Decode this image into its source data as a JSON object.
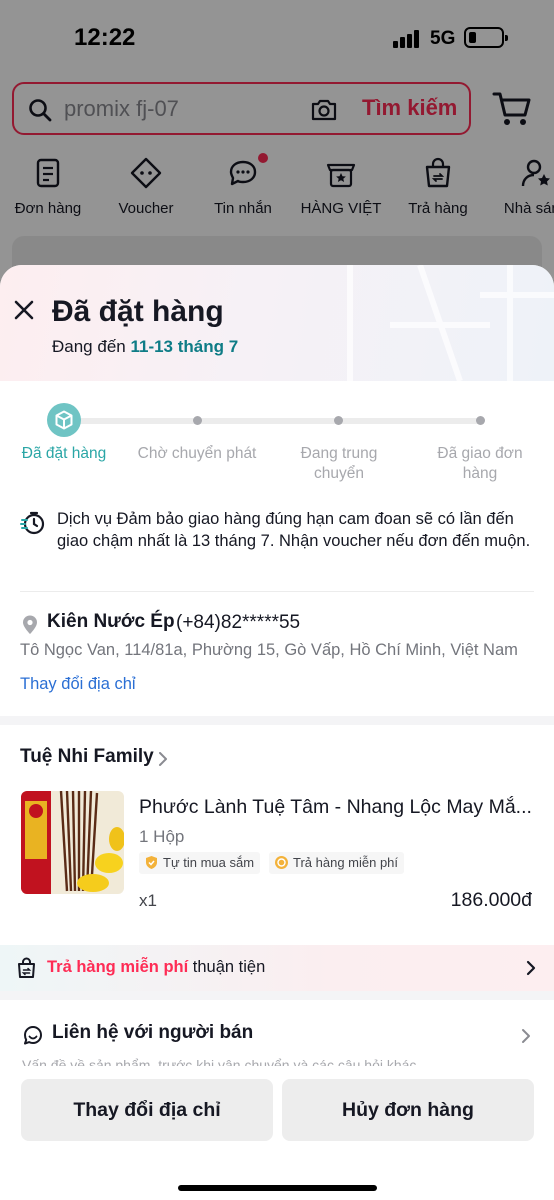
{
  "status_bar": {
    "time": "12:22",
    "network": "5G"
  },
  "search": {
    "placeholder": "promix fj-07",
    "button": "Tìm kiếm"
  },
  "quick_actions": [
    {
      "label": "Đơn hàng",
      "icon": "orders-icon"
    },
    {
      "label": "Voucher",
      "icon": "voucher-icon"
    },
    {
      "label": "Tin nhắn",
      "icon": "message-icon"
    },
    {
      "label": "HÀNG VIỆT",
      "icon": "vietnam-goods-icon"
    },
    {
      "label": "Trả hàng",
      "icon": "return-icon"
    },
    {
      "label": "Nhà sáng",
      "icon": "creator-icon"
    }
  ],
  "order": {
    "title": "Đã đặt hàng",
    "eta_prefix": "Đang đến",
    "eta_dates": "11-13 tháng 7",
    "steps": [
      "Đã đặt hàng",
      "Chờ chuyển phát",
      "Đang trung chuyển",
      "Đã giao đơn hàng"
    ],
    "active_step": 0,
    "guarantee_notice": "Dịch vụ Đảm bảo giao hàng đúng hạn cam đoan sẽ có lần đến giao chậm nhất là 13 tháng 7. Nhận voucher nếu đơn đến muộn."
  },
  "address": {
    "name": "Kiên Nước Ép",
    "phone": "(+84)82*****55",
    "line": "Tô Ngọc Van, 114/81a, Phường 15, Gò Vấp, Hồ Chí Minh, Việt Nam",
    "change_link": "Thay đổi địa chỉ"
  },
  "shop": {
    "name": "Tuệ Nhi Family"
  },
  "product": {
    "name": "Phước Lành Tuệ Tâm - Nhang Lộc May Mắ...",
    "variant": "1 Hộp",
    "tags": [
      "Tự tin mua sắm",
      "Trả hàng miễn phí"
    ],
    "quantity": "x1",
    "price": "186.000đ"
  },
  "return_banner": {
    "highlight": "Trả hàng miễn phí",
    "rest": " thuận tiện"
  },
  "contact": {
    "label": "Liên hệ với người bán",
    "sub": "Vấn đề về sản phẩm, trước khi vận chuyển và các câu hỏi khác"
  },
  "footer": {
    "change_address": "Thay đổi địa chỉ",
    "cancel_order": "Hủy đơn hàng"
  },
  "colors": {
    "brand": "#fe2c55",
    "teal": "#2aa6a6",
    "link": "#2b6fd4"
  }
}
